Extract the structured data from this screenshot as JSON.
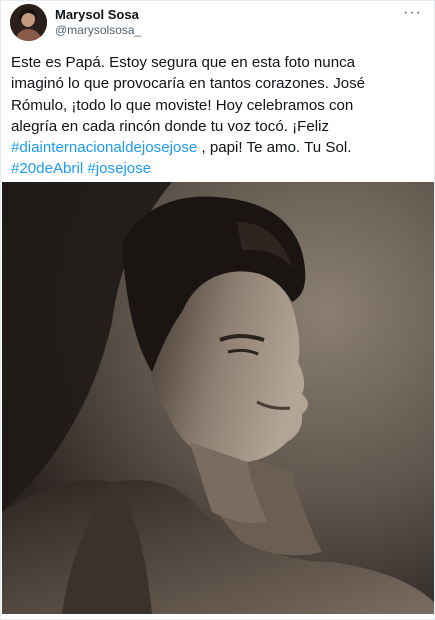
{
  "author": {
    "display_name": "Marysol Sosa",
    "handle": "@marysolsosa_",
    "avatar_icon": "user-avatar"
  },
  "menu_icon": "more-options-icon",
  "tweet": {
    "text_lines": [
      "Este es Papá. Estoy segura que en esta foto nunca",
      "imaginó lo que provocaría en tantos corazones. José",
      "Rómulo, ¡todo lo que moviste! Hoy celebramos con",
      "alegría en cada rincón donde tu voz tocó. ¡Feliz"
    ],
    "hashtag_1": "#diainternacionaldejosejose",
    "after_hashtag_1": " , papi! Te amo. Tu Sol.",
    "hashtag_2": "#20deAbril",
    "hashtag_3": "#josejose"
  },
  "colors": {
    "link": "#1d9bf0",
    "text": "#0f1419",
    "secondary": "#536471"
  }
}
